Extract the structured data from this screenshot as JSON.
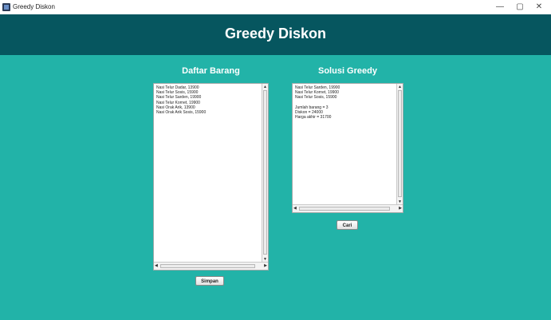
{
  "window": {
    "title": "Greedy Diskon",
    "minimize_label": "—",
    "maximize_label": "▢",
    "close_label": "✕"
  },
  "header": {
    "title": "Greedy Diskon"
  },
  "left_panel": {
    "heading": "Daftar Barang",
    "lines": "Nasi Telur Dadar, 13900\nNasi Telur Sosis, 15900\nNasi Telur Sarden, 19900\nNasi Telur Kornet, 19900\nNasi Orak Arik, 13900\nNasi Orak Arik Sosis, 15900",
    "button_label": "Simpan"
  },
  "right_panel": {
    "heading": "Solusi Greedy",
    "lines": "Nasi Telur Sarden, 19900\nNasi Telur Kornet, 19900\nNasi Telur Sosis, 15900\n\nJumlah barang = 3\nDiskon = 24000\nHarga akhir = 31700",
    "button_label": "Cari"
  },
  "icons": {
    "app": "app-icon",
    "scroll_up": "▲",
    "scroll_down": "▼",
    "scroll_left": "◀",
    "scroll_right": "▶"
  },
  "colors": {
    "header_bg": "#06565f",
    "main_bg": "#22b3a8"
  }
}
